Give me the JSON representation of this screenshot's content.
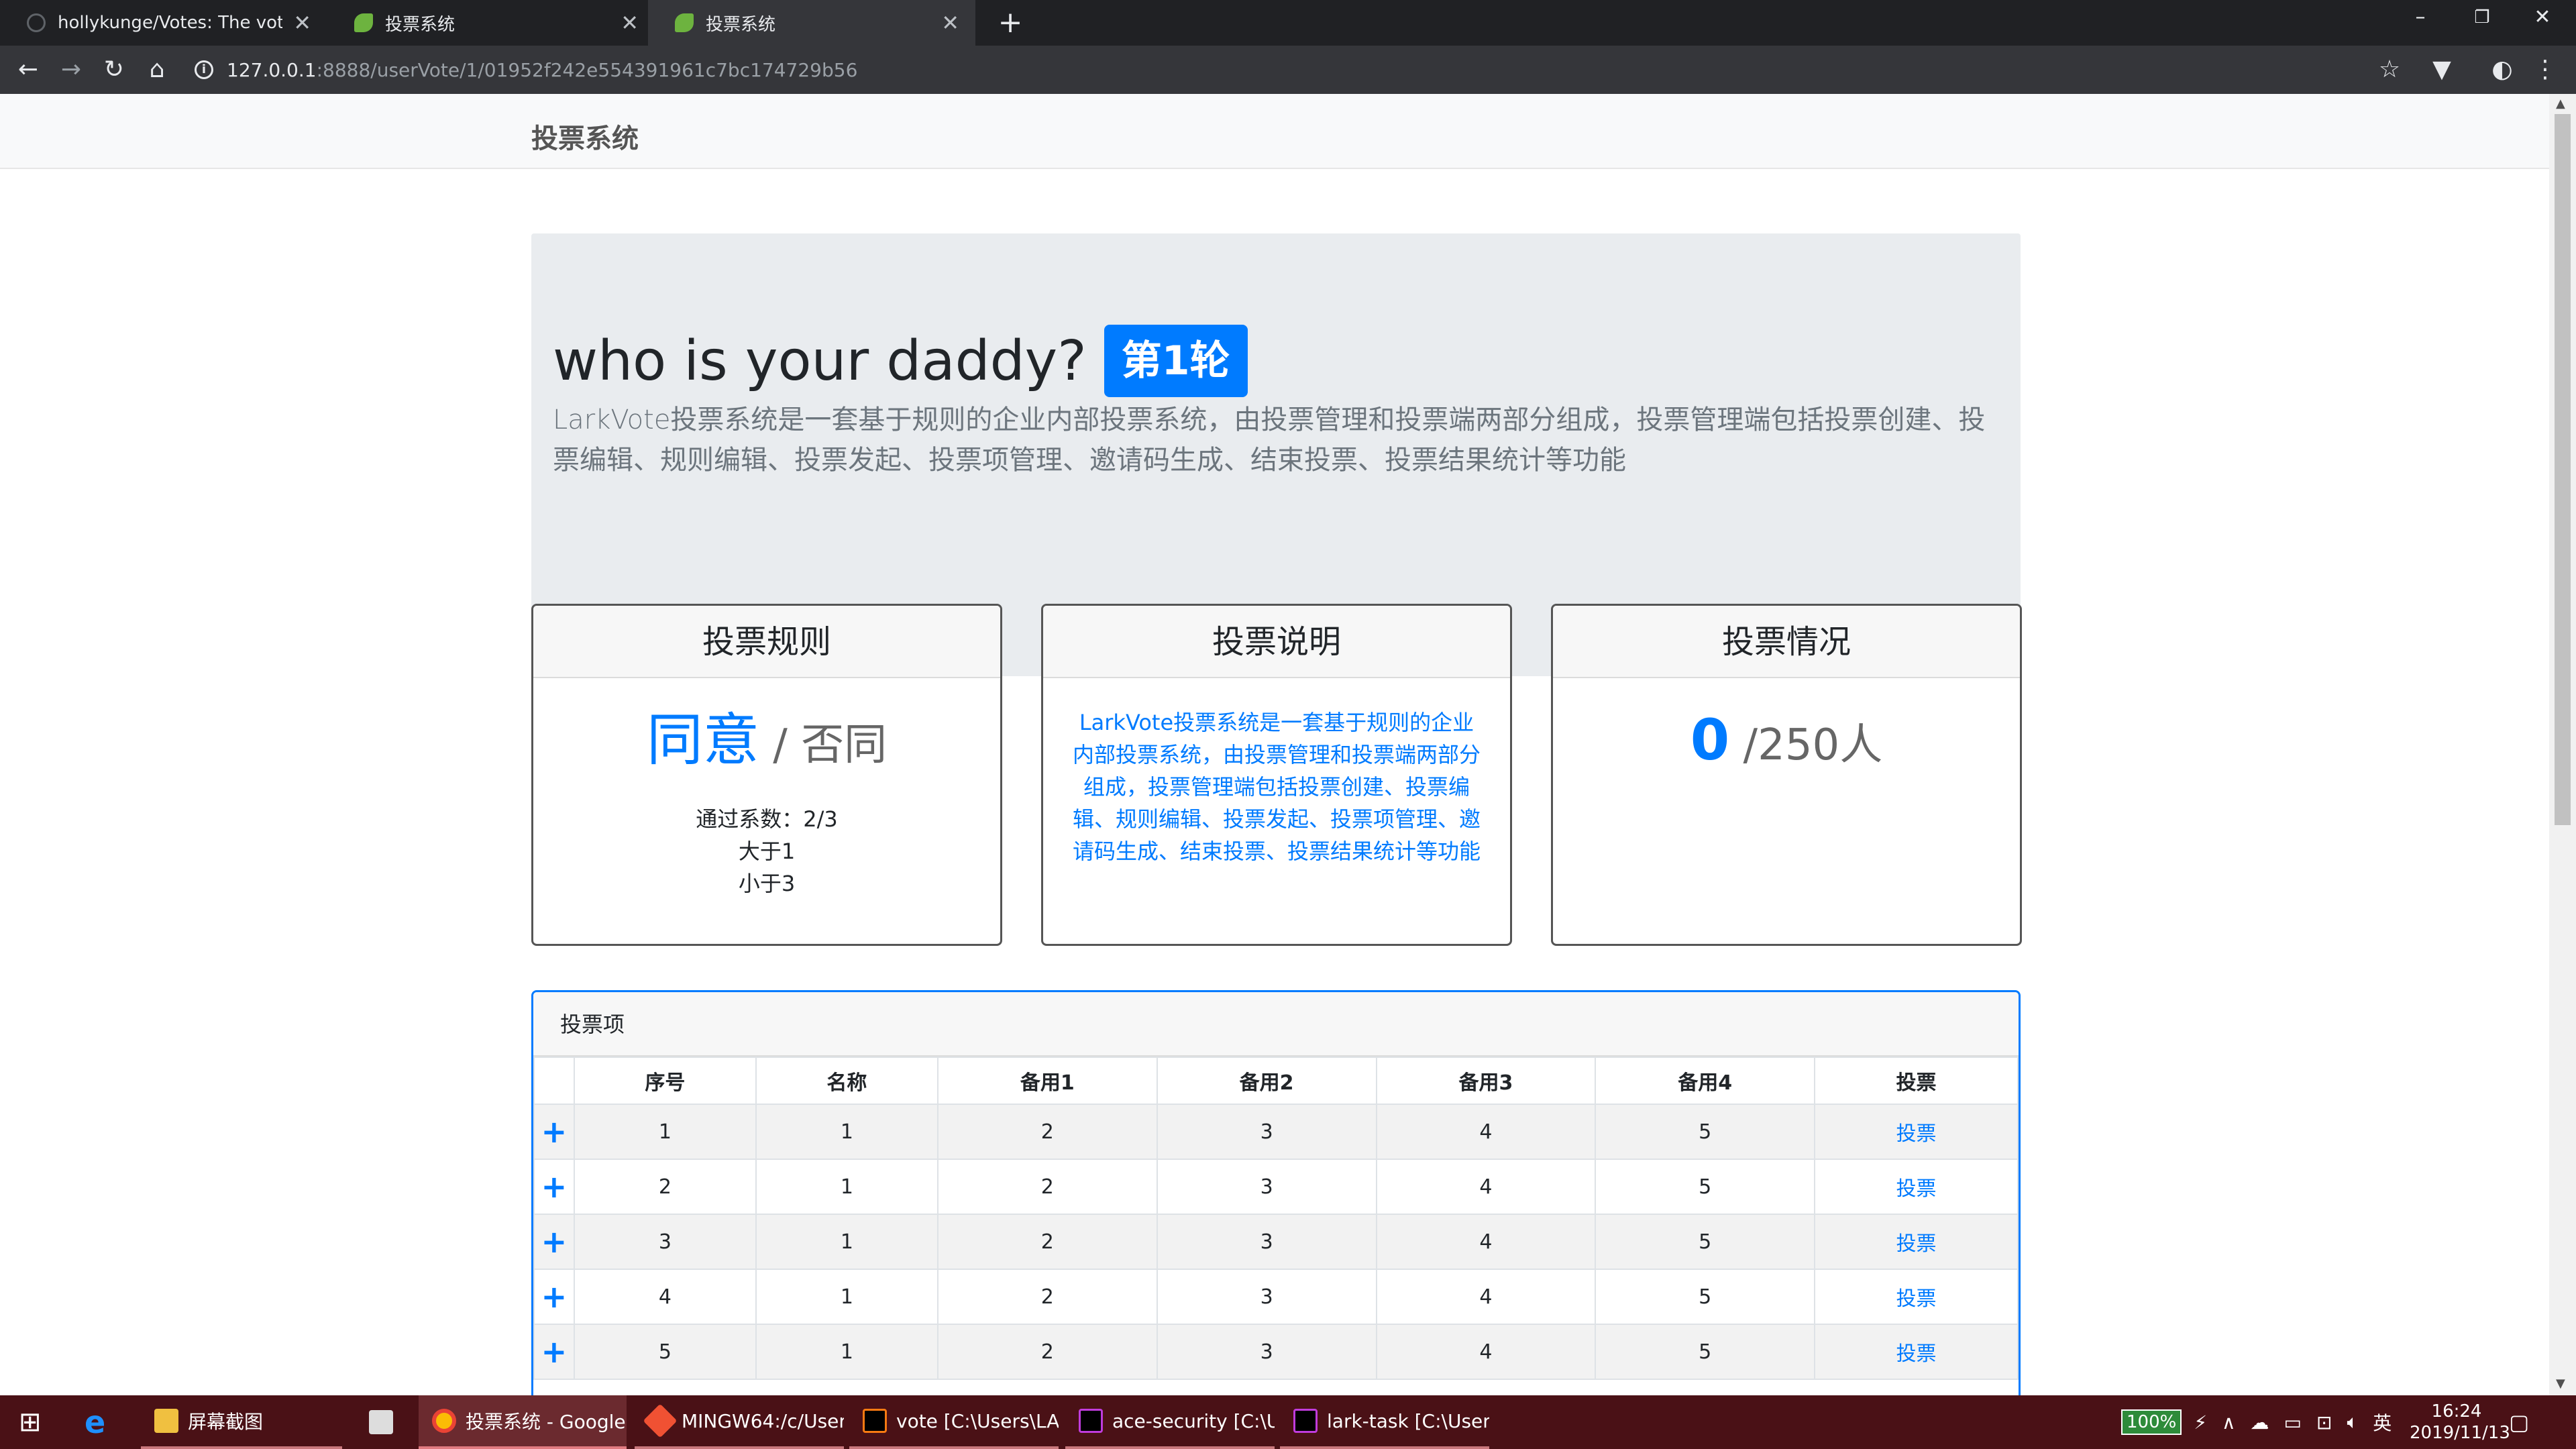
{
  "browser": {
    "tabs": [
      {
        "label": "hollykunge/Votes: The voting",
        "active": false
      },
      {
        "label": "投票系统",
        "active": false
      },
      {
        "label": "投票系统",
        "active": true
      }
    ],
    "new_tab": "+",
    "url_host": "127.0.0.1",
    "url_rest": ":8888/userVote/1/01952f242e554391961c7bc174729b56",
    "window_controls": {
      "minimize": "–",
      "restore": "❐",
      "close": "✕"
    }
  },
  "navbar": {
    "brand": "投票系统"
  },
  "hero": {
    "title": "who is your daddy?",
    "round_badge": "第1轮",
    "lead": "LarkVote投票系统是一套基于规则的企业内部投票系统，由投票管理和投票端两部分组成，投票管理端包括投票创建、投票编辑、规则编辑、投票发起、投票项管理、邀请码生成、结束投票、投票结果统计等功能"
  },
  "cards": {
    "rules": {
      "header": "投票规则",
      "agree": "同意",
      "disagree": " / 否同",
      "lines": [
        "通过系数：2/3",
        "大于1",
        "小于3"
      ]
    },
    "description": {
      "header": "投票说明",
      "text": "LarkVote投票系统是一套基于规则的企业内部投票系统，由投票管理和投票端两部分组成，投票管理端包括投票创建、投票编辑、规则编辑、投票发起、投票项管理、邀请码生成、结束投票、投票结果统计等功能"
    },
    "status": {
      "header": "投票情况",
      "count": "0",
      "total": " /250人"
    }
  },
  "vote_items": {
    "title": "投票项",
    "columns": [
      "",
      "序号",
      "名称",
      "备用1",
      "备用2",
      "备用3",
      "备用4",
      "投票"
    ],
    "rows": [
      {
        "expand": "+",
        "cells": [
          "1",
          "1",
          "2",
          "3",
          "4",
          "5"
        ],
        "action": "投票"
      },
      {
        "expand": "+",
        "cells": [
          "2",
          "1",
          "2",
          "3",
          "4",
          "5"
        ],
        "action": "投票"
      },
      {
        "expand": "+",
        "cells": [
          "3",
          "1",
          "2",
          "3",
          "4",
          "5"
        ],
        "action": "投票"
      },
      {
        "expand": "+",
        "cells": [
          "4",
          "1",
          "2",
          "3",
          "4",
          "5"
        ],
        "action": "投票"
      },
      {
        "expand": "+",
        "cells": [
          "5",
          "1",
          "2",
          "3",
          "4",
          "5"
        ],
        "action": "投票"
      }
    ]
  },
  "taskbar": {
    "items": [
      {
        "label": "屏幕截图"
      },
      {
        "label": "投票系统 - Google ..."
      },
      {
        "label": "MINGW64:/c/User..."
      },
      {
        "label": "vote [C:\\Users\\LA..."
      },
      {
        "label": "ace-security [C:\\U..."
      },
      {
        "label": "lark-task [C:\\Users..."
      }
    ],
    "battery": "100%",
    "ime": "英",
    "time": "16:24",
    "date": "2019/11/13"
  },
  "colors": {
    "primary": "#007bff",
    "jumbotron": "#e9ecef",
    "taskbar": "#4a1116"
  }
}
